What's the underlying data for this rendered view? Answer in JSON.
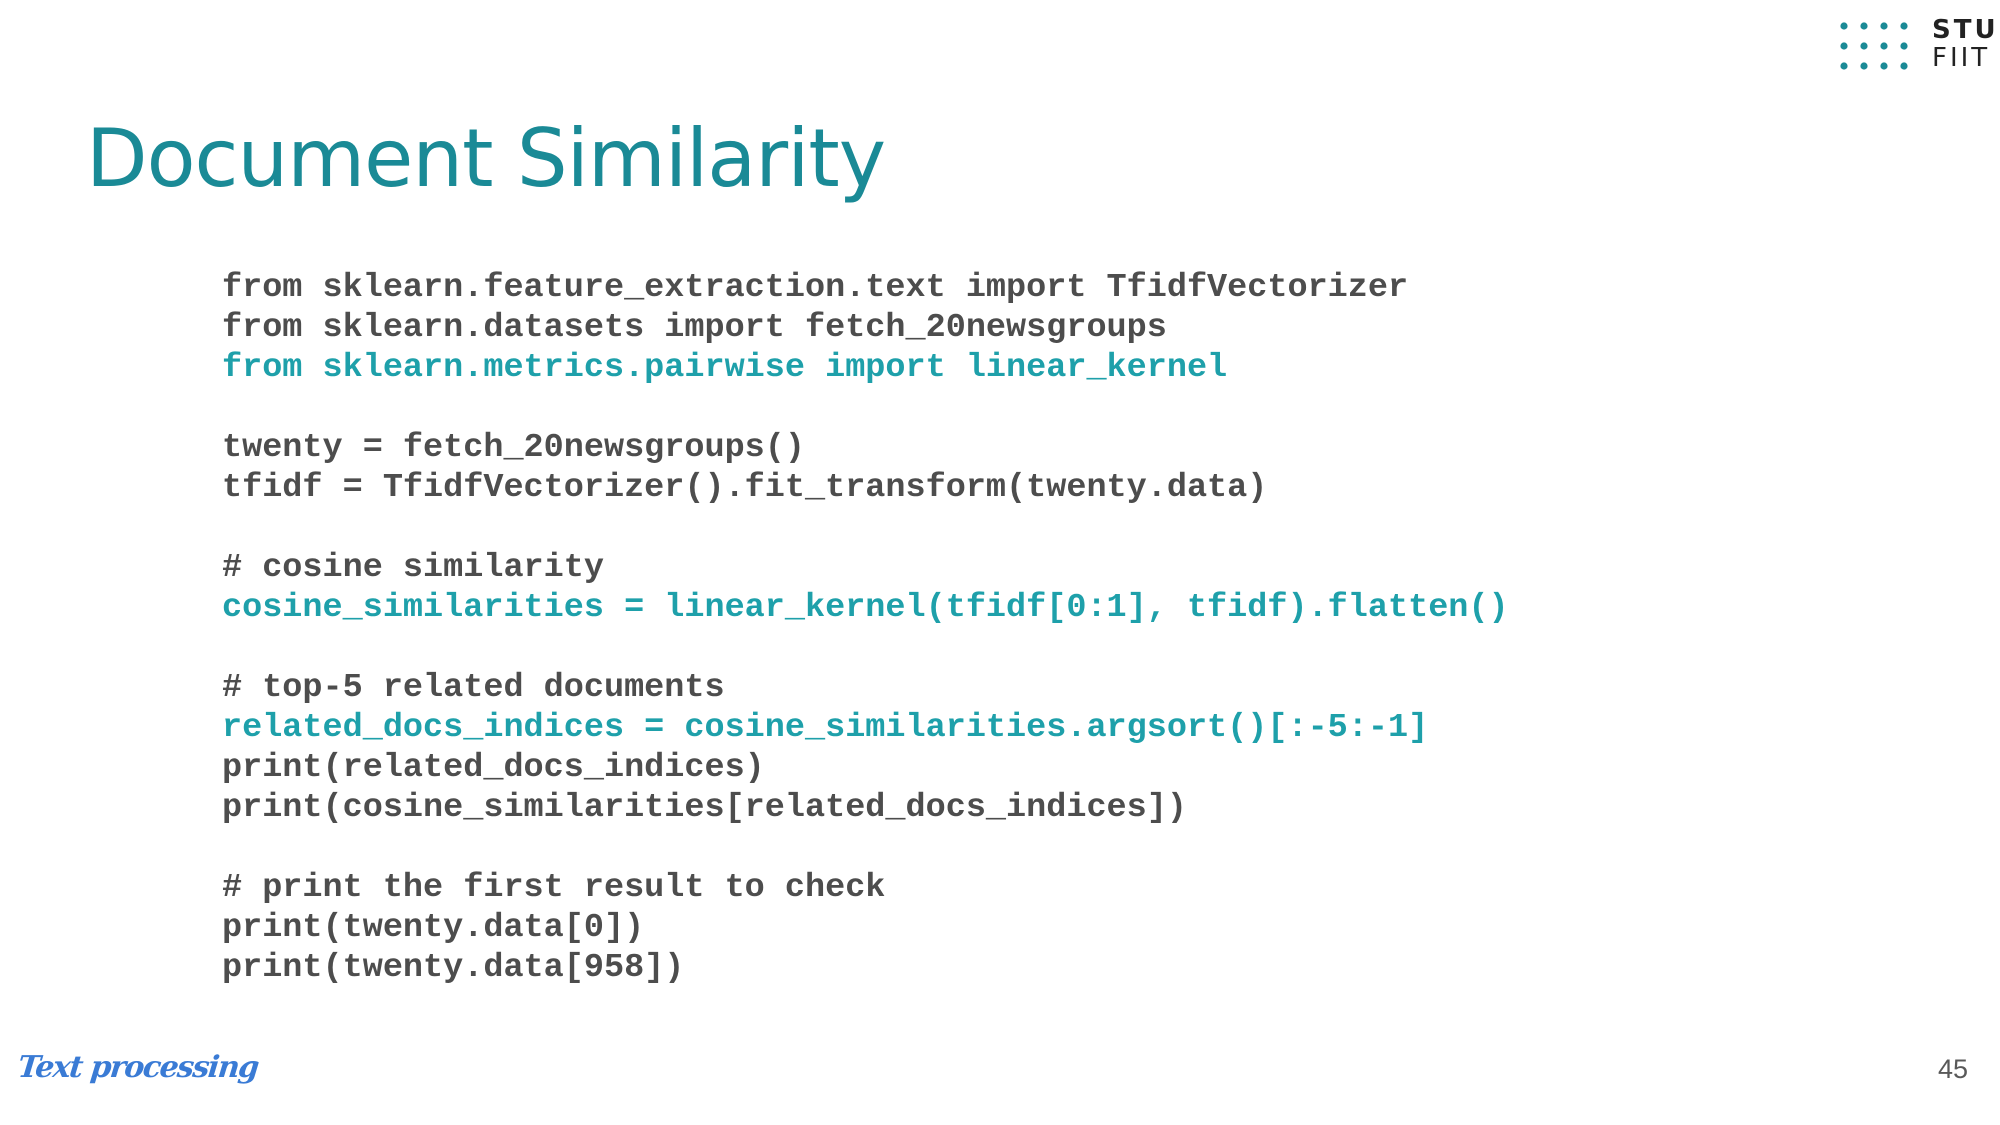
{
  "slide": {
    "title": "Document Similarity",
    "footer_label": "Text processing",
    "page_number": "45"
  },
  "logo": {
    "line1": "STU",
    "line2": "FIIT",
    "icon": "dot-grid-icon",
    "color": "#1a8a96"
  },
  "code": {
    "lines": [
      "from sklearn.feature_extraction.text import TfidfVectorizer",
      "from sklearn.datasets import fetch_20newsgroups",
      "from sklearn.metrics.pairwise import linear_kernel",
      "",
      "twenty = fetch_20newsgroups()",
      "tfidf = TfidfVectorizer().fit_transform(twenty.data)",
      "",
      "# cosine similarity",
      "cosine_similarities = linear_kernel(tfidf[0:1], tfidf).flatten()",
      "",
      "# top-5 related documents",
      "related_docs_indices = cosine_similarities.argsort()[:-5:-1]",
      "print(related_docs_indices)",
      "print(cosine_similarities[related_docs_indices])",
      "",
      "# print the first result to check",
      "print(twenty.data[0])",
      "print(twenty.data[958])"
    ],
    "highlight_color": "#1ea0aa",
    "text_color": "#4d4d4d"
  }
}
